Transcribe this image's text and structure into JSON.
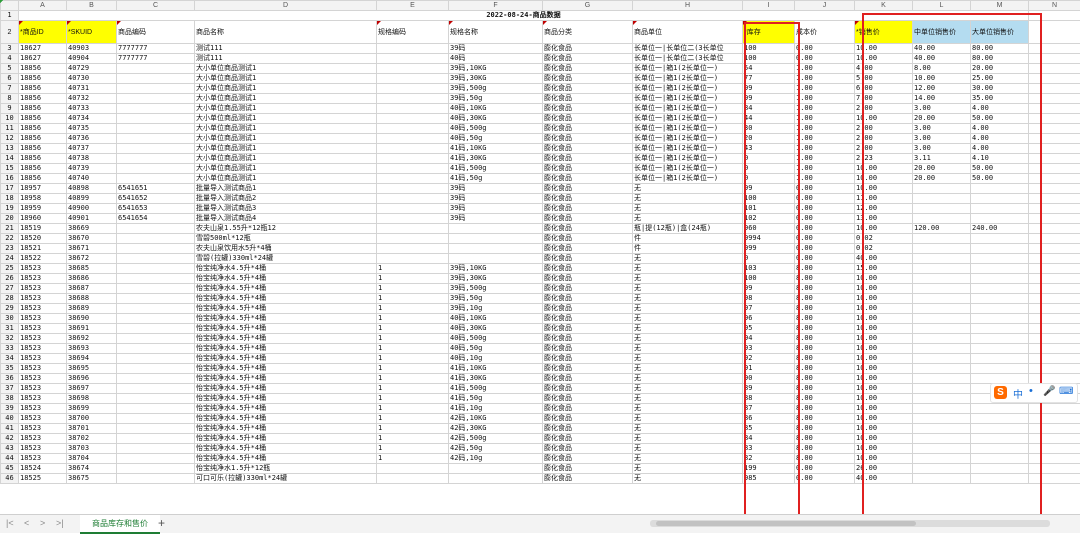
{
  "sheet": {
    "title": "2022-08-24-商品数据",
    "column_letters": [
      "A",
      "B",
      "C",
      "D",
      "E",
      "F",
      "G",
      "H",
      "I",
      "J",
      "K",
      "L",
      "M",
      "N"
    ],
    "headers": [
      "*商品ID",
      "*SKUID",
      "商品编码",
      "商品名称",
      "规格编码",
      "规格名称",
      "商品分类",
      "商品单位",
      "*库存",
      "成本价",
      "*销售价",
      "中单位销售价",
      "大单位销售价",
      ""
    ],
    "rows": [
      [
        "3",
        "18627",
        "40903",
        "7777777",
        "测试111",
        "",
        "39码",
        "膨化食品",
        "长单位一|长单位二(3长单位",
        "100",
        "0.00",
        "10.00",
        "40.00",
        "80.00"
      ],
      [
        "4",
        "18627",
        "40904",
        "7777777",
        "测试111",
        "",
        "40码",
        "膨化食品",
        "长单位一|长单位二(3长单位",
        "100",
        "0.00",
        "10.00",
        "40.00",
        "80.00"
      ],
      [
        "5",
        "18856",
        "40729",
        "",
        "大小单位商品测试1",
        "",
        "39码,10KG",
        "膨化食品",
        "长单位一|箱1(2长单位一)",
        "54",
        "1.00",
        "4.00",
        "8.00",
        "20.00"
      ],
      [
        "6",
        "18856",
        "40730",
        "",
        "大小单位商品测试1",
        "",
        "39码,30KG",
        "膨化食品",
        "长单位一|箱1(2长单位一)",
        "77",
        "1.00",
        "5.00",
        "10.00",
        "25.00"
      ],
      [
        "7",
        "18856",
        "40731",
        "",
        "大小单位商品测试1",
        "",
        "39码,500g",
        "膨化食品",
        "长单位一|箱1(2长单位一)",
        "99",
        "1.00",
        "6.00",
        "12.00",
        "30.00"
      ],
      [
        "8",
        "18856",
        "40732",
        "",
        "大小单位商品测试1",
        "",
        "39码,50g",
        "膨化食品",
        "长单位一|箱1(2长单位一)",
        "99",
        "1.00",
        "7.00",
        "14.00",
        "35.00"
      ],
      [
        "9",
        "18856",
        "40733",
        "",
        "大小单位商品测试1",
        "",
        "40码,10KG",
        "膨化食品",
        "长单位一|箱1(2长单位一)",
        "84",
        "1.00",
        "2.00",
        "3.00",
        "4.00"
      ],
      [
        "10",
        "18856",
        "40734",
        "",
        "大小单位商品测试1",
        "",
        "40码,30KG",
        "膨化食品",
        "长单位一|箱1(2长单位一)",
        "44",
        "1.00",
        "10.00",
        "20.00",
        "50.00"
      ],
      [
        "11",
        "18856",
        "40735",
        "",
        "大小单位商品测试1",
        "",
        "40码,500g",
        "膨化食品",
        "长单位一|箱1(2长单位一)",
        "30",
        "1.00",
        "2.00",
        "3.00",
        "4.00"
      ],
      [
        "12",
        "18856",
        "40736",
        "",
        "大小单位商品测试1",
        "",
        "40码,50g",
        "膨化食品",
        "长单位一|箱1(2长单位一)",
        "20",
        "1.00",
        "2.00",
        "3.00",
        "4.00"
      ],
      [
        "13",
        "18856",
        "40737",
        "",
        "大小单位商品测试1",
        "",
        "41码,10KG",
        "膨化食品",
        "长单位一|箱1(2长单位一)",
        "43",
        "1.00",
        "2.00",
        "3.00",
        "4.00"
      ],
      [
        "14",
        "18856",
        "40738",
        "",
        "大小单位商品测试1",
        "",
        "41码,30KG",
        "膨化食品",
        "长单位一|箱1(2长单位一)",
        "0",
        "1.00",
        "2.23",
        "3.11",
        "4.10"
      ],
      [
        "15",
        "18856",
        "40739",
        "",
        "大小单位商品测试1",
        "",
        "41码,500g",
        "膨化食品",
        "长单位一|箱1(2长单位一)",
        "0",
        "1.00",
        "10.00",
        "20.00",
        "50.00"
      ],
      [
        "16",
        "18856",
        "40740",
        "",
        "大小单位商品测试1",
        "",
        "41码,50g",
        "膨化食品",
        "长单位一|箱1(2长单位一)",
        "0",
        "1.00",
        "10.00",
        "20.00",
        "50.00"
      ],
      [
        "17",
        "18957",
        "40898",
        "6541651",
        "批量导入测试商品1",
        "",
        "39码",
        "膨化食品",
        "无",
        "99",
        "0.00",
        "10.00",
        "",
        ""
      ],
      [
        "18",
        "18958",
        "40899",
        "6541652",
        "批量导入测试商品2",
        "",
        "39码",
        "膨化食品",
        "无",
        "100",
        "0.00",
        "11.00",
        "",
        ""
      ],
      [
        "19",
        "18959",
        "40900",
        "6541653",
        "批量导入测试商品3",
        "",
        "39码",
        "膨化食品",
        "无",
        "101",
        "0.00",
        "12.00",
        "",
        ""
      ],
      [
        "20",
        "18960",
        "40901",
        "6541654",
        "批量导入测试商品4",
        "",
        "39码",
        "膨化食品",
        "无",
        "102",
        "0.00",
        "13.00",
        "",
        ""
      ],
      [
        "21",
        "18519",
        "38669",
        "",
        "农夫山泉1.55升*12瓶12",
        "",
        "",
        "膨化食品",
        "瓶|提(12瓶)|盒(24瓶)",
        "960",
        "0.00",
        "10.00",
        "120.00",
        "240.00"
      ],
      [
        "22",
        "18520",
        "38670",
        "",
        "雪碧500ml*12瓶",
        "",
        "",
        "膨化食品",
        "件",
        "9994",
        "0.00",
        "0.02",
        "",
        ""
      ],
      [
        "23",
        "18521",
        "38671",
        "",
        "农夫山泉饮用水5升*4桶",
        "",
        "",
        "膨化食品",
        "件",
        "999",
        "0.00",
        "0.02",
        "",
        ""
      ],
      [
        "24",
        "18522",
        "38672",
        "",
        "雪碧(拉罐)330ml*24罐",
        "",
        "",
        "膨化食品",
        "无",
        "0",
        "0.00",
        "40.00",
        "",
        ""
      ],
      [
        "25",
        "18523",
        "38685",
        "",
        "怡宝纯净水4.5升*4桶",
        "1",
        "39码,10KG",
        "膨化食品",
        "无",
        "103",
        "8.00",
        "15.00",
        "",
        ""
      ],
      [
        "26",
        "18523",
        "38686",
        "",
        "怡宝纯净水4.5升*4桶",
        "1",
        "39码,30KG",
        "膨化食品",
        "无",
        "100",
        "8.00",
        "10.00",
        "",
        ""
      ],
      [
        "27",
        "18523",
        "38687",
        "",
        "怡宝纯净水4.5升*4桶",
        "1",
        "39码,500g",
        "膨化食品",
        "无",
        "99",
        "8.00",
        "10.00",
        "",
        ""
      ],
      [
        "28",
        "18523",
        "38688",
        "",
        "怡宝纯净水4.5升*4桶",
        "1",
        "39码,50g",
        "膨化食品",
        "无",
        "98",
        "8.00",
        "10.00",
        "",
        ""
      ],
      [
        "29",
        "18523",
        "38689",
        "",
        "怡宝纯净水4.5升*4桶",
        "1",
        "39码,10g",
        "膨化食品",
        "无",
        "97",
        "8.00",
        "10.00",
        "",
        ""
      ],
      [
        "30",
        "18523",
        "38690",
        "",
        "怡宝纯净水4.5升*4桶",
        "1",
        "40码,10KG",
        "膨化食品",
        "无",
        "96",
        "8.00",
        "10.00",
        "",
        ""
      ],
      [
        "31",
        "18523",
        "38691",
        "",
        "怡宝纯净水4.5升*4桶",
        "1",
        "40码,30KG",
        "膨化食品",
        "无",
        "95",
        "8.00",
        "10.00",
        "",
        ""
      ],
      [
        "32",
        "18523",
        "38692",
        "",
        "怡宝纯净水4.5升*4桶",
        "1",
        "40码,500g",
        "膨化食品",
        "无",
        "94",
        "8.00",
        "10.00",
        "",
        ""
      ],
      [
        "33",
        "18523",
        "38693",
        "",
        "怡宝纯净水4.5升*4桶",
        "1",
        "40码,50g",
        "膨化食品",
        "无",
        "93",
        "8.00",
        "10.00",
        "",
        ""
      ],
      [
        "34",
        "18523",
        "38694",
        "",
        "怡宝纯净水4.5升*4桶",
        "1",
        "40码,10g",
        "膨化食品",
        "无",
        "92",
        "8.00",
        "10.00",
        "",
        ""
      ],
      [
        "35",
        "18523",
        "38695",
        "",
        "怡宝纯净水4.5升*4桶",
        "1",
        "41码,10KG",
        "膨化食品",
        "无",
        "91",
        "8.00",
        "10.00",
        "",
        ""
      ],
      [
        "36",
        "18523",
        "38696",
        "",
        "怡宝纯净水4.5升*4桶",
        "1",
        "41码,30KG",
        "膨化食品",
        "无",
        "90",
        "8.00",
        "10.00",
        "",
        ""
      ],
      [
        "37",
        "18523",
        "38697",
        "",
        "怡宝纯净水4.5升*4桶",
        "1",
        "41码,500g",
        "膨化食品",
        "无",
        "89",
        "8.00",
        "10.00",
        "",
        ""
      ],
      [
        "38",
        "18523",
        "38698",
        "",
        "怡宝纯净水4.5升*4桶",
        "1",
        "41码,50g",
        "膨化食品",
        "无",
        "88",
        "8.00",
        "10.00",
        "",
        ""
      ],
      [
        "39",
        "18523",
        "38699",
        "",
        "怡宝纯净水4.5升*4桶",
        "1",
        "41码,10g",
        "膨化食品",
        "无",
        "87",
        "8.00",
        "10.00",
        "",
        ""
      ],
      [
        "40",
        "18523",
        "38700",
        "",
        "怡宝纯净水4.5升*4桶",
        "1",
        "42码,10KG",
        "膨化食品",
        "无",
        "86",
        "8.00",
        "10.00",
        "",
        ""
      ],
      [
        "41",
        "18523",
        "38701",
        "",
        "怡宝纯净水4.5升*4桶",
        "1",
        "42码,30KG",
        "膨化食品",
        "无",
        "85",
        "8.00",
        "10.00",
        "",
        ""
      ],
      [
        "42",
        "18523",
        "38702",
        "",
        "怡宝纯净水4.5升*4桶",
        "1",
        "42码,500g",
        "膨化食品",
        "无",
        "84",
        "8.00",
        "10.00",
        "",
        ""
      ],
      [
        "43",
        "18523",
        "38703",
        "",
        "怡宝纯净水4.5升*4桶",
        "1",
        "42码,50g",
        "膨化食品",
        "无",
        "83",
        "8.00",
        "10.00",
        "",
        ""
      ],
      [
        "44",
        "18523",
        "38704",
        "",
        "怡宝纯净水4.5升*4桶",
        "1",
        "42码,10g",
        "膨化食品",
        "无",
        "82",
        "8.00",
        "10.00",
        "",
        ""
      ],
      [
        "45",
        "18524",
        "38674",
        "",
        "怡宝纯净水1.5升*12瓶",
        "",
        "",
        "膨化食品",
        "无",
        "199",
        "0.00",
        "26.00",
        "",
        ""
      ],
      [
        "46",
        "18525",
        "38675",
        "",
        "可口可乐(拉罐)330ml*24罐",
        "",
        "",
        "膨化食品",
        "无",
        "985",
        "0.00",
        "40.00",
        "",
        ""
      ]
    ]
  },
  "tabs": {
    "nav_prev_first": "|<",
    "nav_prev": "<",
    "nav_next": ">",
    "nav_last": ">|",
    "active_sheet": "商品库存和售价",
    "add": "+"
  },
  "ime": {
    "logo": "S",
    "lang": "中",
    "dot": "•",
    "mic": "🎤",
    "keyboard": "⌨"
  },
  "colors": {
    "header_yellow": "#ffff00",
    "header_blue": "#b4dcf0",
    "highlight_red": "#e02020",
    "tab_green": "#1e7d34"
  }
}
